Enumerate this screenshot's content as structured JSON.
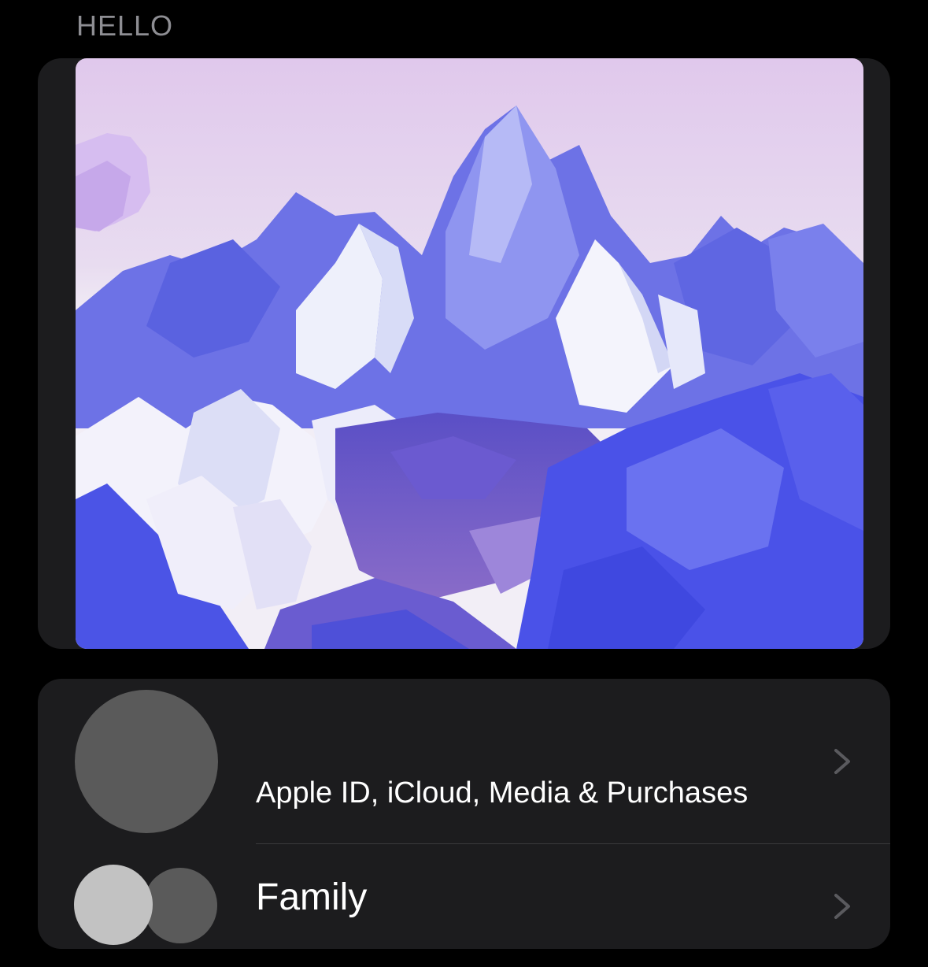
{
  "header": {
    "section_title": "HELLO"
  },
  "hero": {
    "image_subject": "low-poly mountain landscape wallpaper"
  },
  "account_list": {
    "items": [
      {
        "label": "Apple ID, iCloud, Media & Purchases",
        "icon": "avatar-icon"
      },
      {
        "label": "Family",
        "icon": "family-icon"
      }
    ]
  },
  "colors": {
    "background": "#000000",
    "card": "#1c1c1e",
    "secondary_text": "#8e8e93",
    "chevron": "#5a5a5e"
  }
}
